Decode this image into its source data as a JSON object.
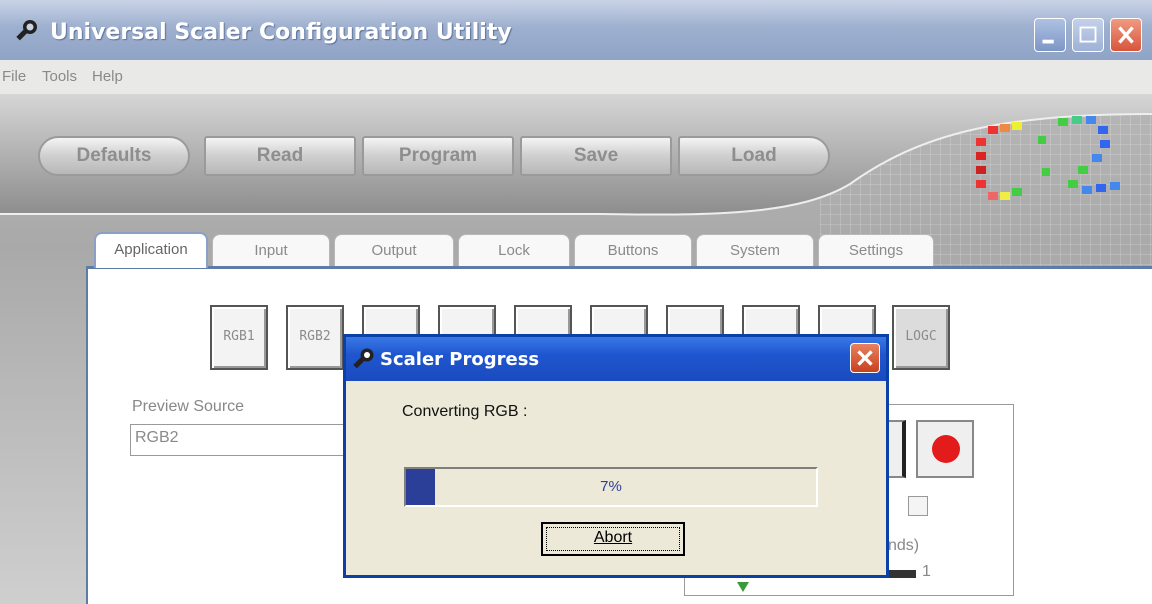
{
  "window": {
    "title": "Universal Scaler Configuration Utility",
    "title_icon": "wrench-icon",
    "controls": [
      "minimize",
      "maximize",
      "close"
    ]
  },
  "menu": [
    "File",
    "Tools",
    "Help"
  ],
  "toolbar": {
    "defaults": "Defaults",
    "read": "Read",
    "program": "Program",
    "save": "Save",
    "load": "Load"
  },
  "tabs": [
    "Application",
    "Input",
    "Output",
    "Lock",
    "Buttons",
    "System",
    "Settings"
  ],
  "active_tab": "Application",
  "sources": {
    "rgb1": "RGB1",
    "rgb2": "RGB2",
    "logo": "LOGC"
  },
  "preview": {
    "label": "Preview Source",
    "value": "RGB2"
  },
  "partial_labels": {
    "seconds_fragment": "nds)",
    "slider_value": "1"
  },
  "dialog": {
    "title": "Scaler Progress",
    "message": "Converting RGB :",
    "progress_percent": 7,
    "progress_label": "7%",
    "abort": "Abort"
  },
  "colors": {
    "record": "#e31b1b",
    "dialog_title": "#1f56d0",
    "progress": "#2b3f99"
  }
}
